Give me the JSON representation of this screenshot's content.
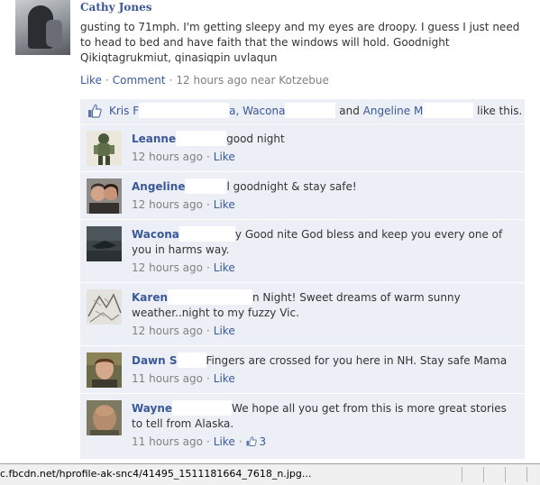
{
  "post": {
    "author": "Cathy Jones",
    "text": "gusting to 71mph. I'm getting sleepy and my eyes are droopy. I guess I just need to head to bed and have faith that the windows will hold. Goodnight Qikiqtagrukmiut, qinasiqpin uvlaqun",
    "like_label": "Like",
    "comment_label": "Comment",
    "time": "12 hours ago near Kotzebue"
  },
  "likes": {
    "name1_start": "Kris F",
    "name1_end": "a,",
    "name2": "Wacona",
    "and_label": "and",
    "name3": "Angeline M",
    "suffix": "like this."
  },
  "comments": [
    {
      "name": "Leanne",
      "text": "good night",
      "time": "12 hours ago",
      "like": "Like",
      "avatar": "figurine-avatar"
    },
    {
      "name": "Angeline",
      "text": "l goodnight & stay safe!",
      "time": "12 hours ago",
      "like": "Like",
      "avatar": "couple-avatar"
    },
    {
      "name": "Wacona",
      "text": "y Good nite God bless and keep you every one of you in harms way.",
      "time": "12 hours ago",
      "like": "Like",
      "avatar": "dark-avatar"
    },
    {
      "name": "Karen",
      "text": "n Night! Sweet dreams of warm sunny weather..night to my fuzzy Vic.",
      "time": "12 hours ago",
      "like": "Like",
      "avatar": "sketch-avatar"
    },
    {
      "name": "Dawn S",
      "text": "Fingers are crossed for you here in NH. Stay safe Mama",
      "time": "11 hours ago",
      "like": "Like",
      "avatar": "person-avatar"
    },
    {
      "name": "Wayne",
      "text": "We hope all you get from this is more great stories to tell from Alaska.",
      "time": "11 hours ago",
      "like": "Like",
      "like_count": "3",
      "avatar": "bald-avatar"
    }
  ],
  "status_bar": {
    "url": "c.fbcdn.net/hprofile-ak-snc4/41495_1511181664_7618_n.jpg..."
  },
  "colors": {
    "link": "#3b5998",
    "meta": "#808080",
    "comment_bg": "#eceff5"
  }
}
